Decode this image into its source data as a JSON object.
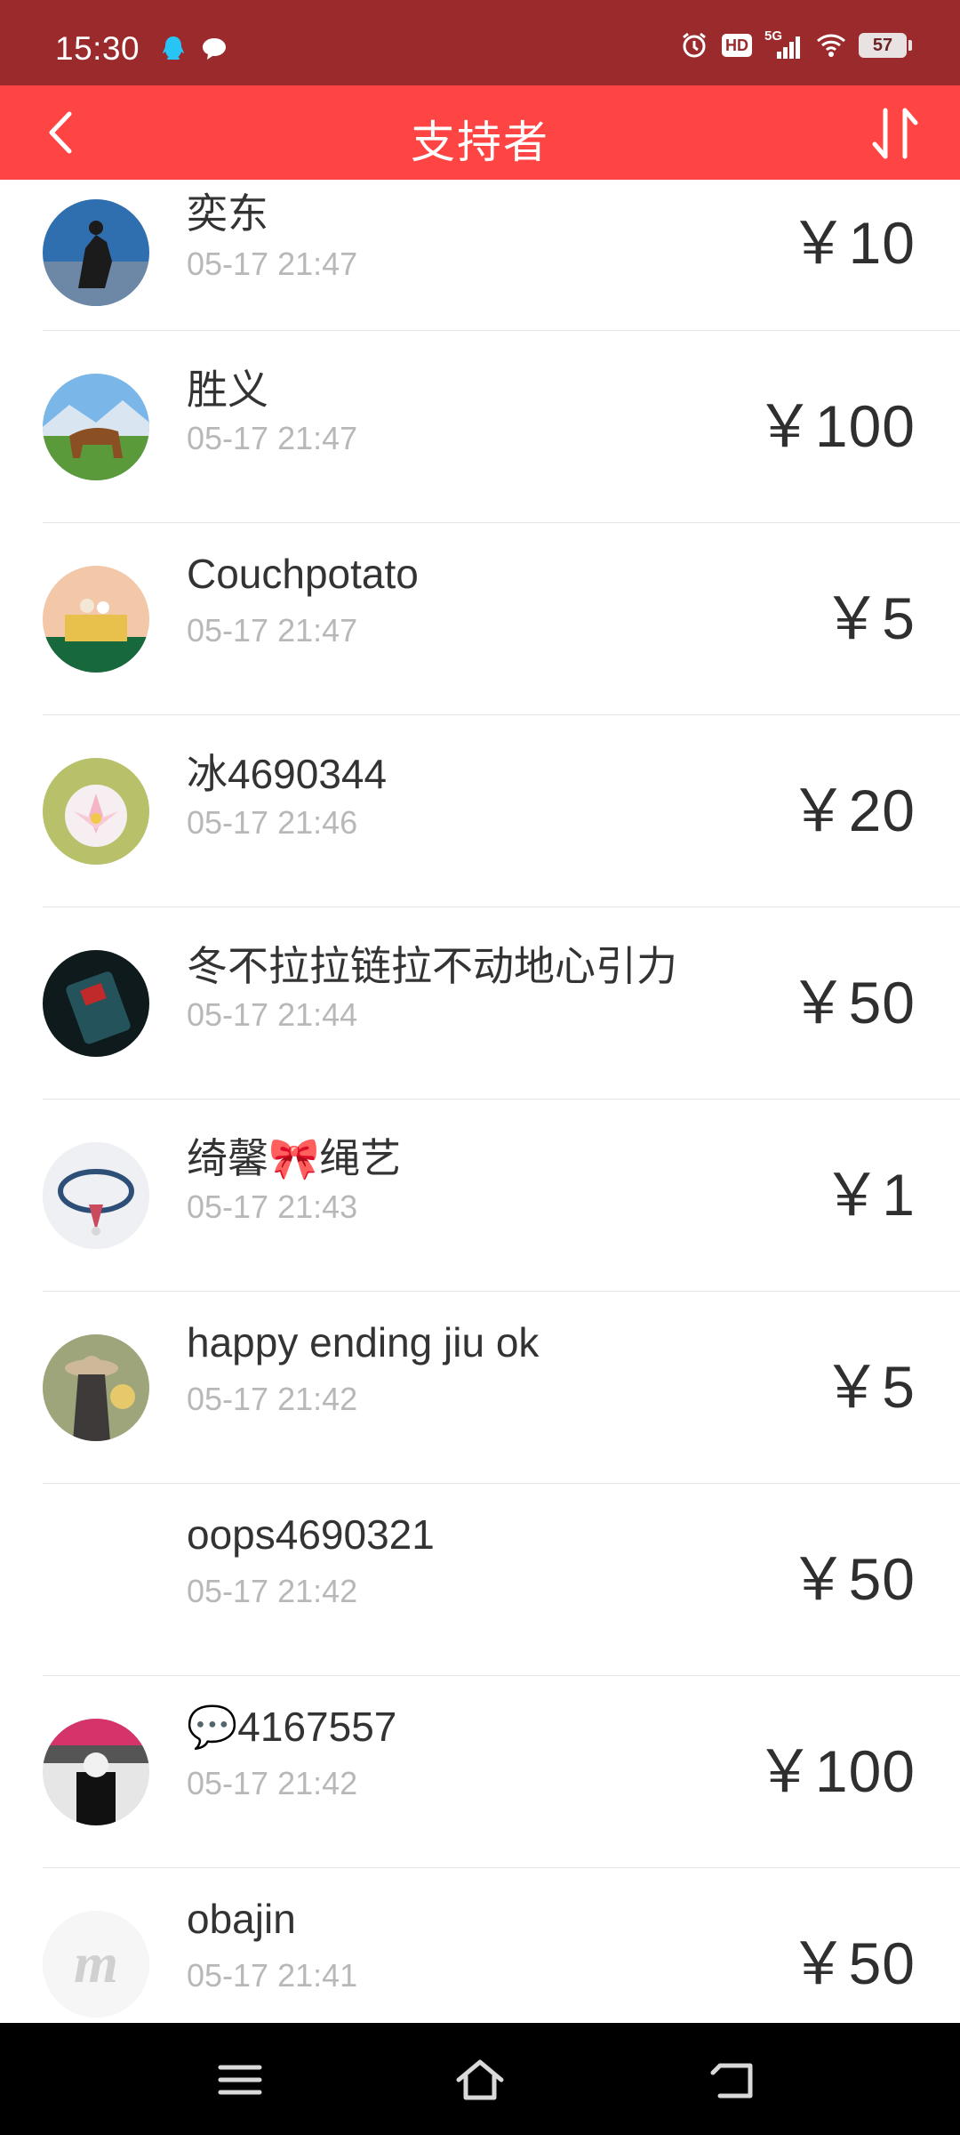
{
  "status_bar": {
    "time": "15:30",
    "battery": "57",
    "icons": [
      "qq-icon",
      "chat-bubble-icon",
      "alarm-icon",
      "hd-icon",
      "5g-signal-icon",
      "wifi-icon",
      "battery-icon"
    ],
    "network": "5G",
    "hd": "HD"
  },
  "app_bar": {
    "title": "支持者",
    "back_icon": "chevron-left-icon",
    "sort_icon": "sort-icon",
    "color": "#ff4444"
  },
  "supporters": [
    {
      "name": "奕东",
      "time": "05-17 21:47",
      "amount": "￥10"
    },
    {
      "name": "胜义",
      "time": "05-17 21:47",
      "amount": "￥100"
    },
    {
      "name": "Couchpotato",
      "time": "05-17 21:47",
      "amount": "￥5"
    },
    {
      "name": "冰4690344",
      "time": "05-17 21:46",
      "amount": "￥20"
    },
    {
      "name": "冬不拉拉链拉不动地心引力",
      "time": "05-17 21:44",
      "amount": "￥50"
    },
    {
      "name": "绮馨🎀绳艺",
      "time": "05-17 21:43",
      "amount": "￥1"
    },
    {
      "name": "happy ending jiu ok",
      "time": "05-17 21:42",
      "amount": "￥5"
    },
    {
      "name": "oops4690321",
      "time": "05-17 21:42",
      "amount": "￥50"
    },
    {
      "name": "💬4167557",
      "time": "05-17 21:42",
      "amount": "￥100"
    },
    {
      "name": "obajin",
      "time": "05-17 21:41",
      "amount": "￥50"
    }
  ],
  "nav_bar": {
    "icons": [
      "menu-icon",
      "home-icon",
      "back-icon"
    ]
  }
}
